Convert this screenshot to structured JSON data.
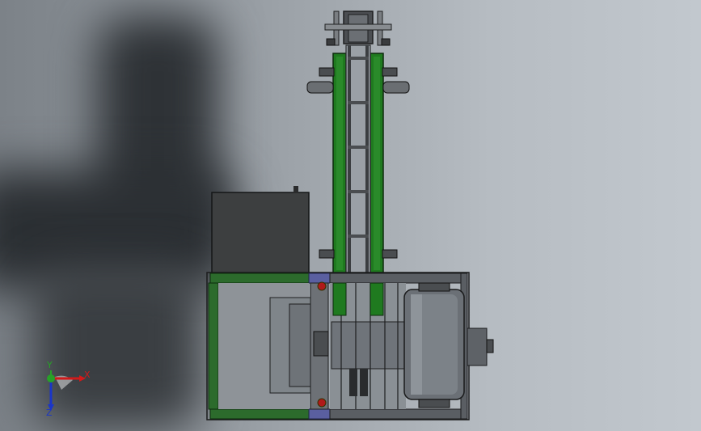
{
  "triad": {
    "x_label": "X",
    "y_label": "Y",
    "z_label": "Z",
    "x_color": "#d11a1a",
    "y_color": "#27a127",
    "z_color": "#1a35c8"
  },
  "colors": {
    "frame_green": "#2c6b2c",
    "belt_green": "#1f7a1f",
    "dark_box": "#3d3f40",
    "steel": "#5a5e63",
    "purple": "#5a5fa0",
    "red": "#b01a1a"
  }
}
